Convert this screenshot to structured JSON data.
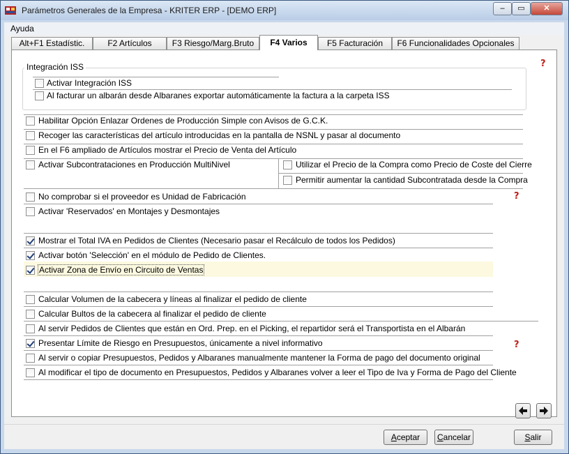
{
  "window": {
    "title": "Parámetros Generales de la Empresa - KRITER ERP - [DEMO ERP]",
    "minimize": "–",
    "restore": "▭",
    "close": "✕"
  },
  "menu": {
    "ayuda": "Ayuda"
  },
  "tabs": [
    {
      "label": "Alt+F1 Estadístic."
    },
    {
      "label": "F2 Artículos"
    },
    {
      "label": "F3 Riesgo/Marg.Bruto"
    },
    {
      "label": "F4 Varios"
    },
    {
      "label": "F5 Facturación"
    },
    {
      "label": "F6 Funcionalidades Opcionales"
    }
  ],
  "integracion": {
    "title": "Integración ISS",
    "items": [
      {
        "label": "Activar Integración ISS",
        "checked": false
      },
      {
        "label": "Al facturar un albarán desde Albaranes exportar automáticamente la factura a la carpeta ISS",
        "checked": false
      }
    ]
  },
  "options": [
    {
      "label": "Habilitar Opción Enlazar Ordenes de Producción Simple con Avisos de G.C.K.",
      "checked": false
    },
    {
      "label": "Recoger las características del artículo introducidas en la pantalla de NSNL y pasar al documento",
      "checked": false
    },
    {
      "label": "En el F6 ampliado de Artículos mostrar el Precio de Venta del Artículo",
      "checked": false
    },
    {
      "label": "Activar Subcontrataciones en Producción MultiNivel",
      "checked": false
    },
    {
      "label": "Utilizar el Precio de la Compra como Precio de Coste del Cierre",
      "checked": false
    },
    {
      "label": "Permitir aumentar la cantidad Subcontratada desde la Compra",
      "checked": false
    },
    {
      "label": "No comprobar si el proveedor es Unidad de Fabricación",
      "checked": false
    },
    {
      "label": "Activar 'Reservados' en Montajes y Desmontajes",
      "checked": false
    },
    {
      "label": "Mostrar el Total IVA en Pedidos de Clientes (Necesario pasar el Recálculo de todos los Pedidos)",
      "checked": true
    },
    {
      "label": "Activar botón 'Selección' en el módulo de Pedido de Clientes.",
      "checked": true
    },
    {
      "label": "Activar Zona de Envío en Circuito de Ventas",
      "checked": true
    },
    {
      "label": "Calcular Volumen de la cabecera y líneas al finalizar el pedido de cliente",
      "checked": false
    },
    {
      "label": "Calcular Bultos de la cabecera al finalizar el pedido de cliente",
      "checked": false
    },
    {
      "label": "Al servir Pedidos de Clientes que están en Ord. Prep. en el Picking, el repartidor será el Transportista en el Albarán",
      "checked": false
    },
    {
      "label": "Presentar Límite de Riesgo en Presupuestos, únicamente a nivel informativo",
      "checked": true
    },
    {
      "label": "Al servir o copiar Presupuestos, Pedidos y Albaranes manualmente mantener la Forma de pago del documento original",
      "checked": false
    },
    {
      "label": "Al modificar el tipo de documento en Presupuestos, Pedidos y Albaranes volver a leer el Tipo de Iva y Forma de Pago del Cliente",
      "checked": false
    }
  ],
  "buttons": {
    "aceptar_u": "A",
    "aceptar_rest": "ceptar",
    "cancelar_u": "C",
    "cancelar_rest": "ancelar",
    "salir_u": "S",
    "salir_rest": "alir"
  },
  "icons": {
    "help": "help-icon",
    "prev": "arrow-left-icon",
    "next": "arrow-right-icon",
    "app": "app-icon"
  },
  "colors": {
    "help_red": "#c0201c",
    "highlight": "#fcf9e0",
    "check": "#1f3f7a"
  }
}
